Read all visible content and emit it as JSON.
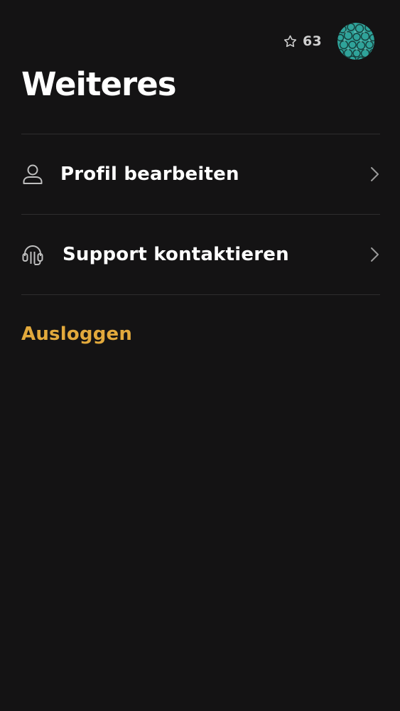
{
  "header": {
    "points": "63",
    "avatar_icon": "avatar-pattern-icon"
  },
  "page": {
    "title": "Weiteres"
  },
  "menu": {
    "items": [
      {
        "label": "Profil bearbeiten",
        "icon": "user-icon"
      },
      {
        "label": "Support kontaktieren",
        "icon": "headset-icon"
      }
    ]
  },
  "logout": {
    "label": "Ausloggen"
  },
  "colors": {
    "background": "#141314",
    "text": "#ffffff",
    "muted": "#cfcfcf",
    "divider": "#2e2d2e",
    "accent": "#e2a93c",
    "avatar": "#2fa39a"
  }
}
